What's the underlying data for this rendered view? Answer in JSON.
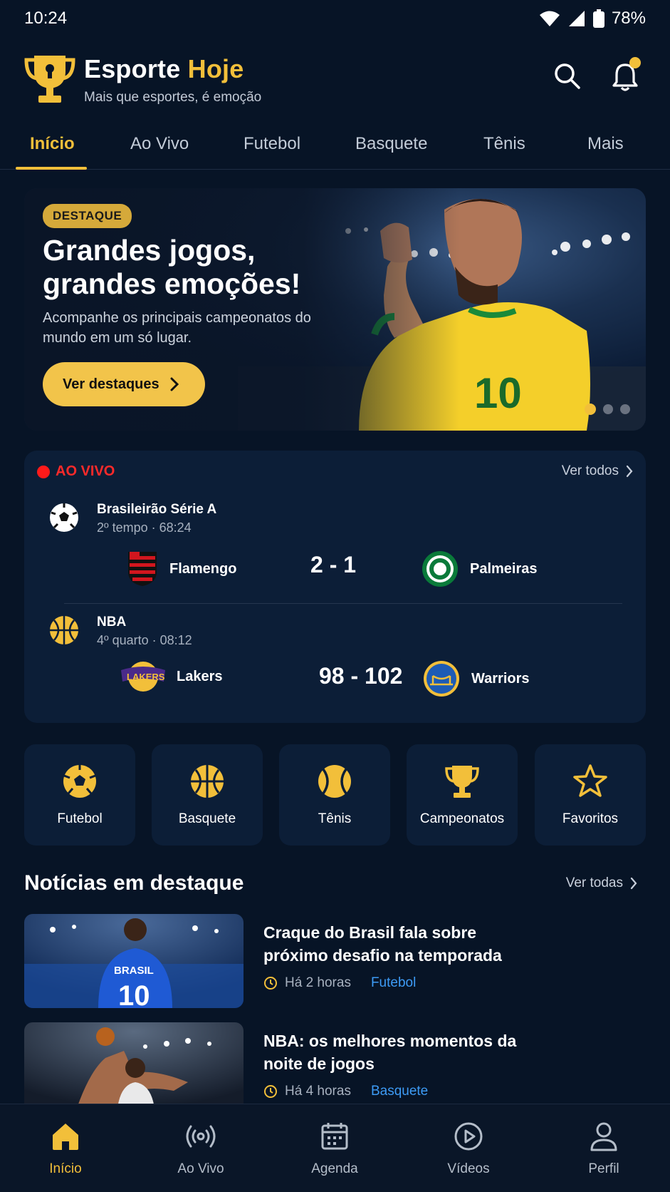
{
  "status": {
    "time": "10:24",
    "battery": "78%"
  },
  "header": {
    "brand_main": "Esporte",
    "brand_accent": "Hoje",
    "tagline": "Mais que esportes, é emoção"
  },
  "tabs": [
    {
      "label": "Início",
      "active": true
    },
    {
      "label": "Ao Vivo"
    },
    {
      "label": "Futebol"
    },
    {
      "label": "Basquete"
    },
    {
      "label": "Tênis"
    },
    {
      "label": "Mais"
    }
  ],
  "hero": {
    "badge": "DESTAQUE",
    "title": "Grandes jogos, grandes emoções!",
    "subtitle": "Acompanhe os principais campeonatos do mundo em um só lugar.",
    "button": "Ver destaques",
    "jersey_number": "10"
  },
  "live": {
    "label": "AO VIVO",
    "see_all": "Ver todos",
    "matches": [
      {
        "league": "Brasileirão Série A",
        "time": "2º tempo · 68:24",
        "home": "Flamengo",
        "score": "2 - 1",
        "away": "Palmeiras"
      },
      {
        "league": "NBA",
        "time": "4º quarto · 08:12",
        "home": "Lakers",
        "score": "98 - 102",
        "away": "Warriors"
      }
    ]
  },
  "categories": [
    {
      "label": "Futebol",
      "icon": "soccer-ball-icon"
    },
    {
      "label": "Basquete",
      "icon": "basketball-icon"
    },
    {
      "label": "Tênis",
      "icon": "tennis-ball-icon"
    },
    {
      "label": "Campeonatos",
      "icon": "trophy-icon"
    },
    {
      "label": "Favoritos",
      "icon": "star-icon"
    }
  ],
  "news": {
    "title": "Notícias em destaque",
    "see_all": "Ver todas",
    "items": [
      {
        "headline": "Craque do Brasil fala sobre próximo desafio na temporada",
        "time": "Há 2 horas",
        "category": "Futebol",
        "jersey": "10",
        "jersey_name": "BRASIL"
      },
      {
        "headline": "NBA: os melhores momentos da noite de jogos",
        "time": "Há 4 horas",
        "category": "Basquete"
      }
    ]
  },
  "bottom_nav": [
    {
      "label": "Início",
      "active": true
    },
    {
      "label": "Ao Vivo"
    },
    {
      "label": "Agenda"
    },
    {
      "label": "Vídeos"
    },
    {
      "label": "Perfil"
    }
  ],
  "colors": {
    "background": "#071426",
    "card": "#0c1e37",
    "accent": "#f2bf3a",
    "live": "#ff1a1a",
    "link": "#3d9bf5"
  }
}
